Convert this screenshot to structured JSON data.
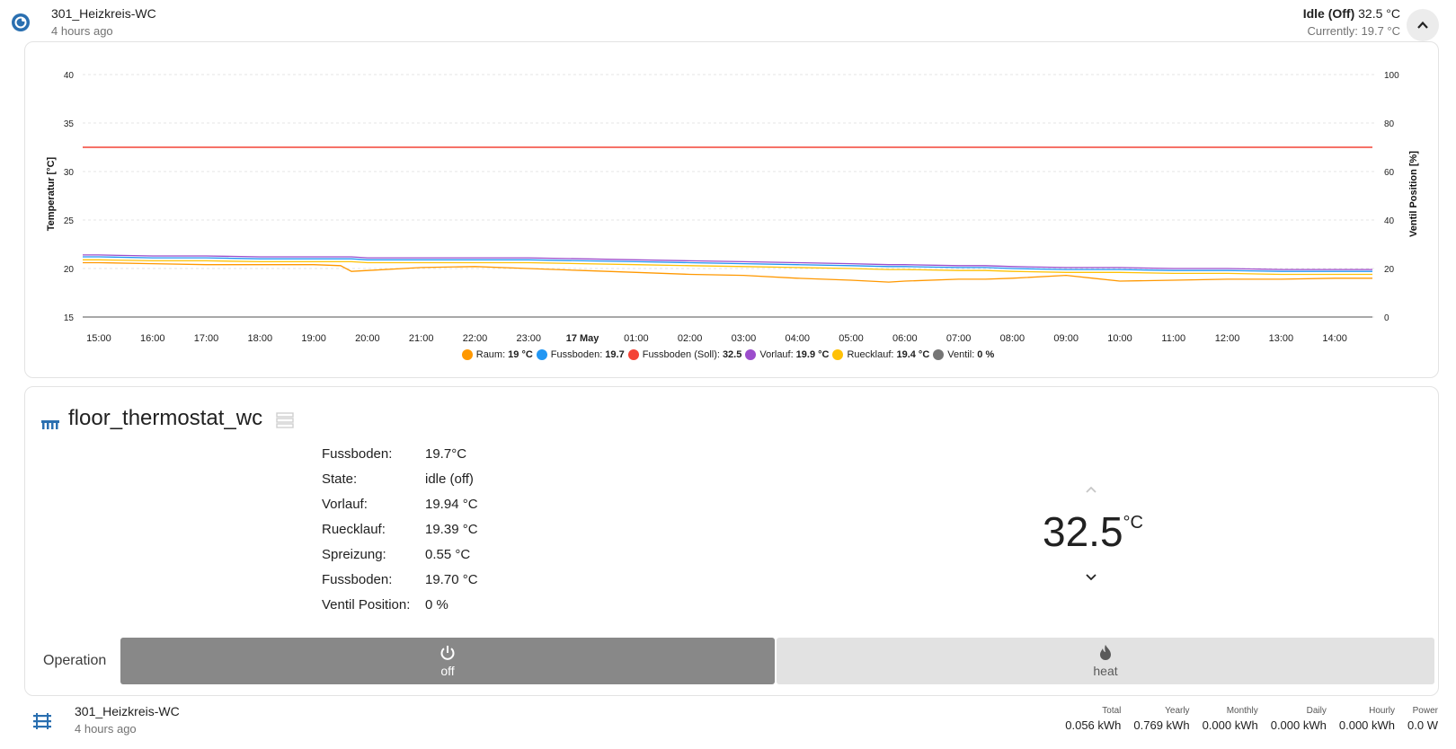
{
  "header": {
    "name": "301_Heizkreis-WC",
    "time": "4 hours ago",
    "state_bold": "Idle (Off)",
    "state_value": "32.5 °C",
    "current": "Currently: 19.7 °C"
  },
  "colors": {
    "raum": "#ff9800",
    "fussboden": "#2196f3",
    "soll": "#f44336",
    "vorlauf": "#9c4dcc",
    "ruecklauf": "#ffc107",
    "ventil": "#757575",
    "heater_blue": "#2a6fb0",
    "off_button": "#888888",
    "heat_button": "#e2e2e2"
  },
  "chart_data": {
    "type": "line",
    "xlabel": "",
    "ylabel": "Temperatur [°C]",
    "y2label": "Ventil Position [%]",
    "ylim": [
      15,
      40
    ],
    "y2lim": [
      0,
      100
    ],
    "yticks": [
      "15",
      "20",
      "25",
      "30",
      "35",
      "40"
    ],
    "y2ticks": [
      "0",
      "20",
      "40",
      "60",
      "80",
      "100"
    ],
    "xticks": [
      "15:00",
      "16:00",
      "17:00",
      "18:00",
      "19:00",
      "20:00",
      "21:00",
      "22:00",
      "23:00",
      "17 May",
      "01:00",
      "02:00",
      "03:00",
      "04:00",
      "05:00",
      "06:00",
      "07:00",
      "08:00",
      "09:00",
      "10:00",
      "11:00",
      "12:00",
      "13:00",
      "14:00"
    ],
    "x_hours": [
      14.7,
      15,
      16,
      17,
      18,
      19,
      19.5,
      19.7,
      20,
      21,
      22,
      23,
      24,
      25,
      26,
      27,
      28,
      29,
      29.7,
      30,
      31,
      31.5,
      32,
      33,
      33.5,
      34,
      35,
      36,
      37,
      38,
      38.7
    ],
    "grid": true,
    "legend_position": "bottom",
    "series": [
      {
        "name": "Raum",
        "legend_value": "19 °C",
        "axis": "left",
        "color_key": "raum",
        "values": [
          20.6,
          20.6,
          20.5,
          20.4,
          20.4,
          20.4,
          20.3,
          19.7,
          19.8,
          20.1,
          20.2,
          20.0,
          19.8,
          19.6,
          19.4,
          19.3,
          19.0,
          18.8,
          18.6,
          18.7,
          18.9,
          18.9,
          19.0,
          19.3,
          19.0,
          18.7,
          18.8,
          18.9,
          18.9,
          19.0,
          19.0
        ]
      },
      {
        "name": "Fussboden",
        "legend_value": "19.7",
        "axis": "left",
        "color_key": "fussboden",
        "values": [
          21.2,
          21.2,
          21.1,
          21.1,
          21.0,
          21.0,
          21.0,
          21.0,
          20.9,
          20.9,
          20.9,
          20.9,
          20.8,
          20.7,
          20.6,
          20.5,
          20.4,
          20.3,
          20.2,
          20.2,
          20.1,
          20.1,
          20.0,
          19.9,
          19.9,
          19.9,
          19.8,
          19.8,
          19.7,
          19.7,
          19.7
        ]
      },
      {
        "name": "Fussboden (Soll)",
        "legend_value": "32.5",
        "axis": "left",
        "color_key": "soll",
        "values": [
          32.5,
          32.5,
          32.5,
          32.5,
          32.5,
          32.5,
          32.5,
          32.5,
          32.5,
          32.5,
          32.5,
          32.5,
          32.5,
          32.5,
          32.5,
          32.5,
          32.5,
          32.5,
          32.5,
          32.5,
          32.5,
          32.5,
          32.5,
          32.5,
          32.5,
          32.5,
          32.5,
          32.5,
          32.5,
          32.5,
          32.5
        ]
      },
      {
        "name": "Vorlauf",
        "legend_value": "19.9 °C",
        "axis": "left",
        "color_key": "vorlauf",
        "values": [
          21.4,
          21.4,
          21.3,
          21.3,
          21.2,
          21.2,
          21.2,
          21.2,
          21.1,
          21.1,
          21.1,
          21.1,
          21.0,
          20.9,
          20.8,
          20.7,
          20.6,
          20.5,
          20.4,
          20.4,
          20.3,
          20.3,
          20.2,
          20.1,
          20.1,
          20.1,
          20.0,
          20.0,
          19.9,
          19.9,
          19.9
        ]
      },
      {
        "name": "Ruecklauf",
        "legend_value": "19.4 °C",
        "axis": "left",
        "color_key": "ruecklauf",
        "values": [
          20.9,
          20.9,
          20.8,
          20.8,
          20.7,
          20.7,
          20.7,
          20.7,
          20.6,
          20.6,
          20.6,
          20.6,
          20.5,
          20.4,
          20.3,
          20.2,
          20.1,
          20.0,
          19.9,
          19.9,
          19.8,
          19.8,
          19.7,
          19.6,
          19.6,
          19.6,
          19.5,
          19.5,
          19.4,
          19.4,
          19.4
        ]
      },
      {
        "name": "Ventil",
        "legend_value": "0 %",
        "axis": "right",
        "color_key": "ventil",
        "values": [
          0,
          0,
          0,
          0,
          0,
          0,
          0,
          0,
          0,
          0,
          0,
          0,
          0,
          0,
          0,
          0,
          0,
          0,
          0,
          0,
          0,
          0,
          0,
          0,
          0,
          0,
          0,
          0,
          0,
          0,
          0
        ]
      }
    ]
  },
  "thermostat": {
    "title": "floor_thermostat_wc",
    "attributes": [
      {
        "key": "Fussboden:",
        "value": "19.7°C"
      },
      {
        "key": "State:",
        "value": "idle (off)"
      },
      {
        "key": "Vorlauf:",
        "value": "19.94 °C"
      },
      {
        "key": "Ruecklauf:",
        "value": "19.39 °C"
      },
      {
        "key": "Spreizung:",
        "value": "0.55 °C"
      },
      {
        "key": "Fussboden:",
        "value": "19.70 °C"
      },
      {
        "key": "Ventil Position:",
        "value": "0 %"
      }
    ],
    "target": "32.5",
    "unit": "°C",
    "operation_label": "Operation",
    "modes": {
      "off": "off",
      "heat": "heat"
    },
    "up_icon": "chevron-up-icon",
    "down_icon": "chevron-down-icon"
  },
  "footer": {
    "name": "301_Heizkreis-WC",
    "time": "4 hours ago",
    "stats": [
      {
        "label": "Total",
        "value": "0.056 kWh"
      },
      {
        "label": "Yearly",
        "value": "0.769 kWh"
      },
      {
        "label": "Monthly",
        "value": "0.000 kWh"
      },
      {
        "label": "Daily",
        "value": "0.000 kWh"
      },
      {
        "label": "Hourly",
        "value": "0.000 kWh"
      },
      {
        "label": "Power",
        "value": "0.0 W"
      }
    ]
  }
}
